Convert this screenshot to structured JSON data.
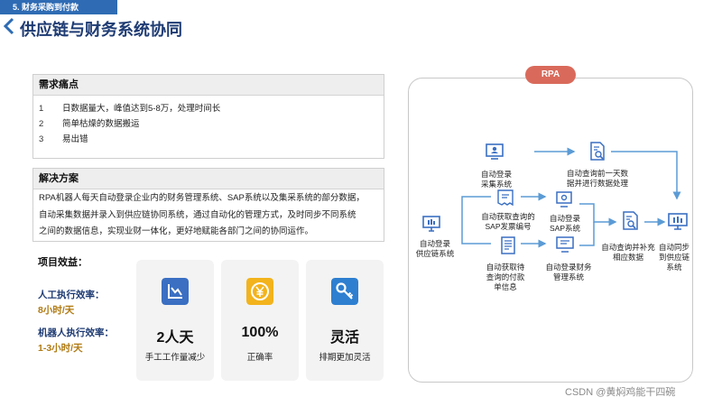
{
  "header": {
    "section_tab": "5. 财务采购到付款",
    "title": "供应链与财务系统协同"
  },
  "pain_points": {
    "heading": "需求痛点",
    "items": [
      {
        "num": "1",
        "text": "日数据量大，峰值达到5-8万，处理时间长"
      },
      {
        "num": "2",
        "text": "简单枯燥的数据搬运"
      },
      {
        "num": "3",
        "text": "易出错"
      }
    ]
  },
  "solution": {
    "heading": "解决方案",
    "lines": [
      "RPA机器人每天自动登录企业内的财务管理系统、SAP系统以及集采系统的部分数据，",
      "自动采集数据并录入到供应链协同系统，通过自动化的管理方式，及时同步不同系统",
      "之间的数据信息，实现业财一体化，更好地赋能各部门之间的协同运作。"
    ]
  },
  "benefits": {
    "title": "项目效益：",
    "manual_label": "人工执行效率：",
    "manual_value": "8小时/天",
    "robot_label": "机器人执行效率：",
    "robot_value": "1-3小时/天",
    "cards": [
      {
        "value": "2人天",
        "desc": "手工工作量减少",
        "icon": "chart-down-icon",
        "color": "#3a6fc2"
      },
      {
        "value": "100%",
        "desc": "正确率",
        "icon": "yen-coin-icon",
        "color": "#f2b31c"
      },
      {
        "value": "灵活",
        "desc": "排期更加灵活",
        "icon": "key-icon",
        "color": "#2e7fd0"
      }
    ]
  },
  "rpa": {
    "badge": "RPA",
    "nodes": {
      "login_supply": [
        "自动登录",
        "供应链系统"
      ],
      "login_collect": [
        "自动登录",
        "采集系统"
      ],
      "get_sap_invoice": [
        "自动获取查询的",
        "SAP发票编号"
      ],
      "get_pending_payment": [
        "自动获取待",
        "查询的付款",
        "单信息"
      ],
      "login_sap": [
        "自动登录",
        "SAP系统"
      ],
      "login_finance": [
        "自动登录财务",
        "管理系统"
      ],
      "query_prev_day": [
        "自动查询前一天数",
        "据并进行数据处理"
      ],
      "query_supplement": [
        "自动查询并补充",
        "相应数据"
      ],
      "sync_supply": [
        "自动同步",
        "到供应链",
        "系统"
      ]
    }
  },
  "watermark": "CSDN @黄焖鸡能干四碗",
  "colors": {
    "accent": "#2e6bb4",
    "title": "#1e3b73",
    "badge": "#d96a5b",
    "arrow": "#5b9bd5"
  }
}
